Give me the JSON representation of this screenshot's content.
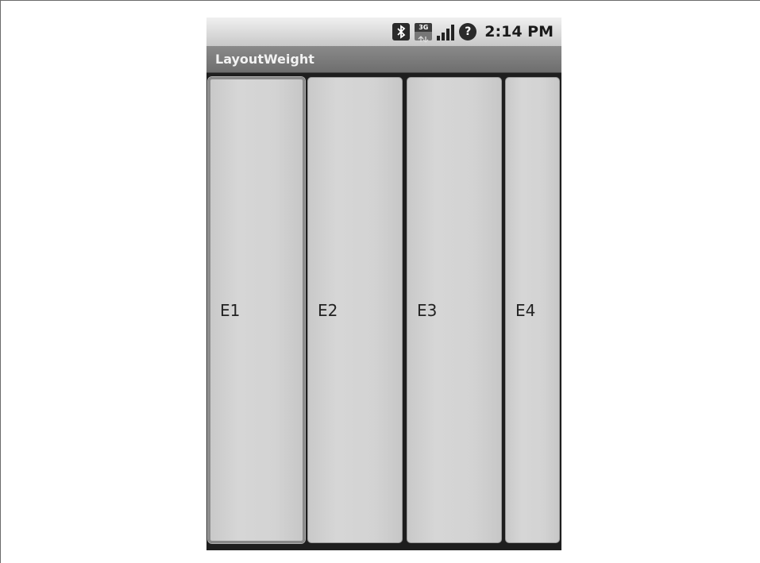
{
  "status_bar": {
    "time": "2:14 PM",
    "icons": [
      "bluetooth-icon",
      "3g-data-icon",
      "signal-strength-icon",
      "unknown-status-icon"
    ],
    "network_label": "3G",
    "unknown_glyph": "?"
  },
  "app": {
    "title": "LayoutWeight"
  },
  "fields": [
    {
      "label": "E1",
      "focused": true
    },
    {
      "label": "E2",
      "focused": false
    },
    {
      "label": "E3",
      "focused": false
    },
    {
      "label": "E4",
      "focused": false
    }
  ]
}
